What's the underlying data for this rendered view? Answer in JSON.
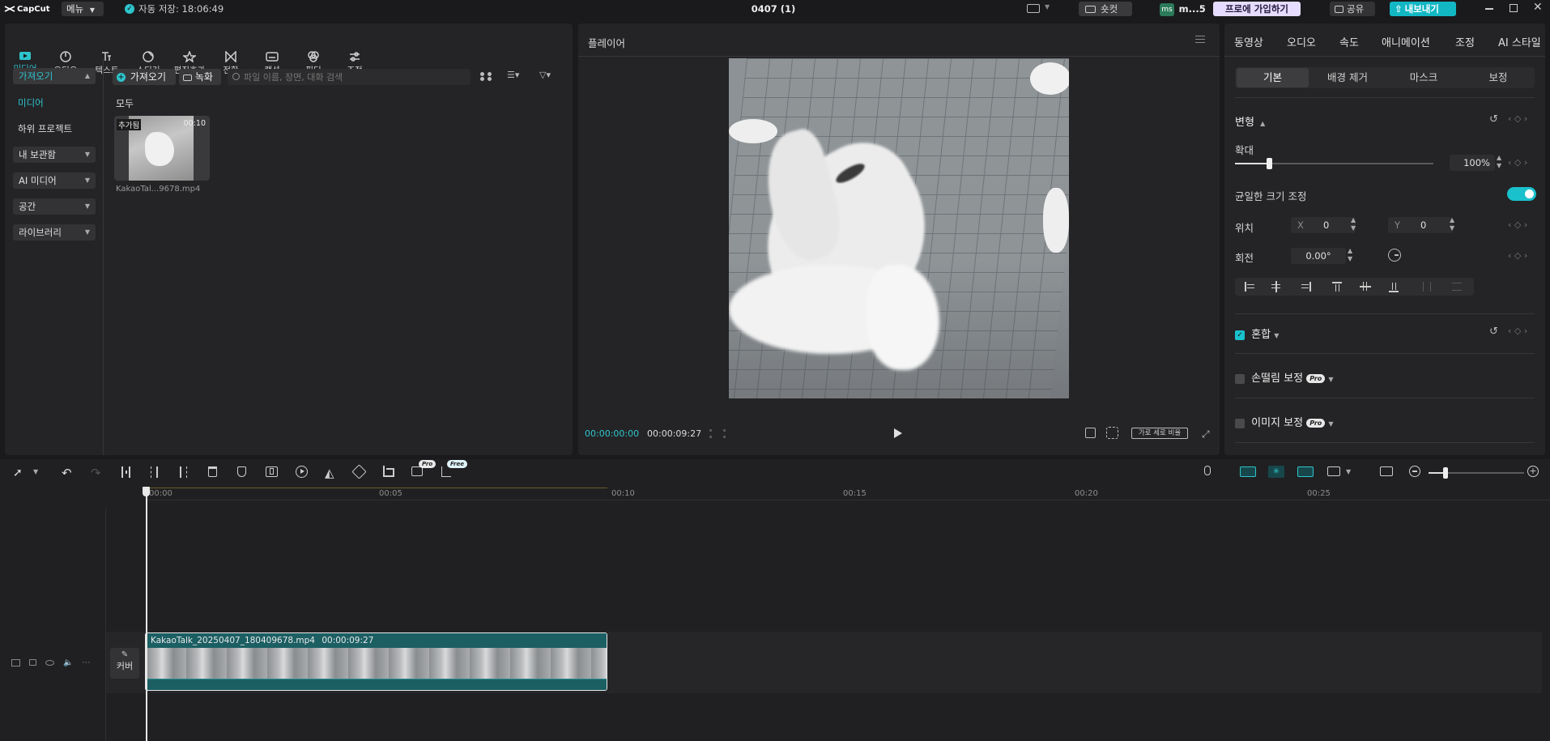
{
  "app": {
    "logo_text": "CapCut",
    "menu_label": "메뉴",
    "autosave": "자동 저장: 18:06:49",
    "project_title": "0407 (1)"
  },
  "titlebar": {
    "shortcut_label": "숏컷",
    "user_initials": "ms",
    "user_name": "m...5",
    "pro_join_label": "프로에 가입하기",
    "share_label": "공유",
    "export_label": "내보내기"
  },
  "media_tabs": [
    {
      "label": "미디어",
      "icon": "media-icon"
    },
    {
      "label": "오디오",
      "icon": "audio-icon"
    },
    {
      "label": "텍스트",
      "icon": "text-icon"
    },
    {
      "label": "스티커",
      "icon": "sticker-icon"
    },
    {
      "label": "편집효과",
      "icon": "effects-icon"
    },
    {
      "label": "전환",
      "icon": "transition-icon"
    },
    {
      "label": "캡션",
      "icon": "caption-icon"
    },
    {
      "label": "필터",
      "icon": "filter-icon"
    },
    {
      "label": "조정",
      "icon": "adjust-icon"
    }
  ],
  "sidebar": {
    "import_group": "가져오기",
    "items": [
      "미디어",
      "하위 프로젝트"
    ],
    "groups": [
      "내 보관함",
      "AI 미디어",
      "공간",
      "라이브러리"
    ]
  },
  "media": {
    "import_button": "가져오기",
    "record_button": "녹화",
    "search_placeholder": "파일 이름, 장면, 대화 검색",
    "section_label": "모두",
    "clip": {
      "added_badge": "추가됨",
      "duration": "00:10",
      "filename": "KakaoTal...9678.mp4"
    }
  },
  "player": {
    "title": "플레이어",
    "current_time": "00:00:00:00",
    "total_time": "00:00:09:27",
    "ratio_label": "가로 세로 비율"
  },
  "inspector": {
    "tabs": [
      "동영상",
      "오디오",
      "속도",
      "애니메이션",
      "조정",
      "AI 스타일"
    ],
    "subtabs": [
      "기본",
      "배경 제거",
      "마스크",
      "보정"
    ],
    "transform_label": "변형",
    "scale_label": "확대",
    "scale_value": "100%",
    "scale_level": 0.17,
    "uniform_label": "균일한 크기 조정",
    "position_label": "위치",
    "pos_x_label": "X",
    "pos_x": "0",
    "pos_y_label": "Y",
    "pos_y": "0",
    "rotation_label": "회전",
    "rotation_value": "0.00°",
    "blend_label": "혼합",
    "stabilize_label": "손떨림 보정",
    "image_enhance_label": "이미지 보정",
    "pro_badge": "Pro"
  },
  "timeline": {
    "ruler_labels": [
      "00:00",
      "00:05",
      "00:10",
      "00:15",
      "00:20",
      "00:25"
    ],
    "tool_badges": {
      "pro": "Pro",
      "free": "Free"
    },
    "cover_label": "커버",
    "clip_name": "KakaoTalk_20250407_180409678.mp4",
    "clip_duration": "00:00:09:27"
  },
  "colors": {
    "accent": "#2ec4cc",
    "clip_header": "#1b5f63",
    "background": "#1a1a1c",
    "panel": "#242426"
  }
}
